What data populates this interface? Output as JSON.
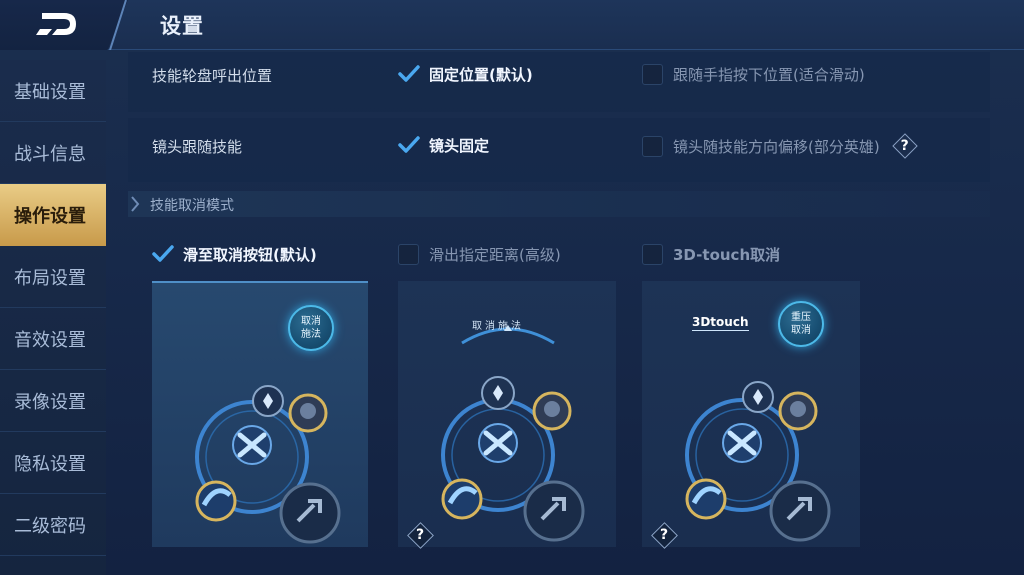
{
  "header": {
    "title": "设置"
  },
  "sidebar": {
    "items": [
      {
        "label": "基础设置"
      },
      {
        "label": "战斗信息"
      },
      {
        "label": "操作设置"
      },
      {
        "label": "布局设置"
      },
      {
        "label": "音效设置"
      },
      {
        "label": "录像设置"
      },
      {
        "label": "隐私设置"
      },
      {
        "label": "二级密码"
      }
    ],
    "active_index": 2
  },
  "settings": {
    "skill_wheel": {
      "label": "技能轮盘呼出位置",
      "option_fixed": "固定位置(默认)",
      "option_follow": "跟随手指按下位置(适合滑动)",
      "fixed_checked": true,
      "follow_checked": false
    },
    "camera": {
      "label": "镜头跟随技能",
      "option_fixed": "镜头固定",
      "option_offset": "镜头随技能方向偏移(部分英雄)",
      "fixed_checked": true,
      "offset_checked": false,
      "help": "?"
    }
  },
  "cancel_mode": {
    "section_title": "技能取消模式",
    "options": [
      {
        "label": "滑至取消按钮(默认)",
        "checked": true
      },
      {
        "label": "滑出指定距离(高级)",
        "checked": false
      },
      {
        "label": "3D-touch取消",
        "checked": false
      }
    ],
    "previews": {
      "card1_bubble_line1": "取消",
      "card1_bubble_line2": "施法",
      "card2_arc_text": "取消施法",
      "card2_help": "?",
      "card3_tag": "3Dtouch",
      "card3_bubble_line1": "重压",
      "card3_bubble_line2": "取消",
      "card3_help": "?"
    }
  },
  "colors": {
    "accent_gold": "#e2c27b",
    "check_blue": "#4aa8f0",
    "bg_navy": "#17294a"
  }
}
